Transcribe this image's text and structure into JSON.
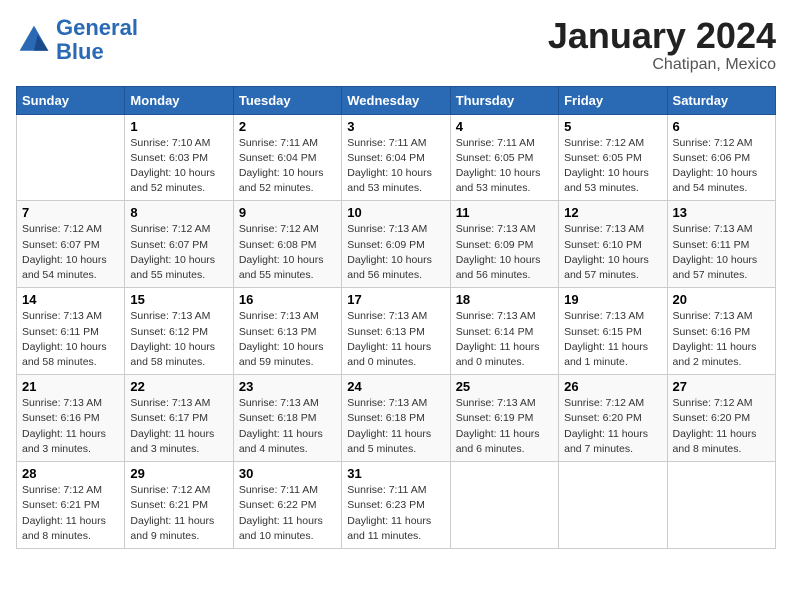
{
  "logo": {
    "text_general": "General",
    "text_blue": "Blue"
  },
  "calendar": {
    "title": "January 2024",
    "subtitle": "Chatipan, Mexico"
  },
  "days_of_week": [
    "Sunday",
    "Monday",
    "Tuesday",
    "Wednesday",
    "Thursday",
    "Friday",
    "Saturday"
  ],
  "weeks": [
    [
      {
        "day": "",
        "info": ""
      },
      {
        "day": "1",
        "info": "Sunrise: 7:10 AM\nSunset: 6:03 PM\nDaylight: 10 hours\nand 52 minutes."
      },
      {
        "day": "2",
        "info": "Sunrise: 7:11 AM\nSunset: 6:04 PM\nDaylight: 10 hours\nand 52 minutes."
      },
      {
        "day": "3",
        "info": "Sunrise: 7:11 AM\nSunset: 6:04 PM\nDaylight: 10 hours\nand 53 minutes."
      },
      {
        "day": "4",
        "info": "Sunrise: 7:11 AM\nSunset: 6:05 PM\nDaylight: 10 hours\nand 53 minutes."
      },
      {
        "day": "5",
        "info": "Sunrise: 7:12 AM\nSunset: 6:05 PM\nDaylight: 10 hours\nand 53 minutes."
      },
      {
        "day": "6",
        "info": "Sunrise: 7:12 AM\nSunset: 6:06 PM\nDaylight: 10 hours\nand 54 minutes."
      }
    ],
    [
      {
        "day": "7",
        "info": "Sunrise: 7:12 AM\nSunset: 6:07 PM\nDaylight: 10 hours\nand 54 minutes."
      },
      {
        "day": "8",
        "info": "Sunrise: 7:12 AM\nSunset: 6:07 PM\nDaylight: 10 hours\nand 55 minutes."
      },
      {
        "day": "9",
        "info": "Sunrise: 7:12 AM\nSunset: 6:08 PM\nDaylight: 10 hours\nand 55 minutes."
      },
      {
        "day": "10",
        "info": "Sunrise: 7:13 AM\nSunset: 6:09 PM\nDaylight: 10 hours\nand 56 minutes."
      },
      {
        "day": "11",
        "info": "Sunrise: 7:13 AM\nSunset: 6:09 PM\nDaylight: 10 hours\nand 56 minutes."
      },
      {
        "day": "12",
        "info": "Sunrise: 7:13 AM\nSunset: 6:10 PM\nDaylight: 10 hours\nand 57 minutes."
      },
      {
        "day": "13",
        "info": "Sunrise: 7:13 AM\nSunset: 6:11 PM\nDaylight: 10 hours\nand 57 minutes."
      }
    ],
    [
      {
        "day": "14",
        "info": "Sunrise: 7:13 AM\nSunset: 6:11 PM\nDaylight: 10 hours\nand 58 minutes."
      },
      {
        "day": "15",
        "info": "Sunrise: 7:13 AM\nSunset: 6:12 PM\nDaylight: 10 hours\nand 58 minutes."
      },
      {
        "day": "16",
        "info": "Sunrise: 7:13 AM\nSunset: 6:13 PM\nDaylight: 10 hours\nand 59 minutes."
      },
      {
        "day": "17",
        "info": "Sunrise: 7:13 AM\nSunset: 6:13 PM\nDaylight: 11 hours\nand 0 minutes."
      },
      {
        "day": "18",
        "info": "Sunrise: 7:13 AM\nSunset: 6:14 PM\nDaylight: 11 hours\nand 0 minutes."
      },
      {
        "day": "19",
        "info": "Sunrise: 7:13 AM\nSunset: 6:15 PM\nDaylight: 11 hours\nand 1 minute."
      },
      {
        "day": "20",
        "info": "Sunrise: 7:13 AM\nSunset: 6:16 PM\nDaylight: 11 hours\nand 2 minutes."
      }
    ],
    [
      {
        "day": "21",
        "info": "Sunrise: 7:13 AM\nSunset: 6:16 PM\nDaylight: 11 hours\nand 3 minutes."
      },
      {
        "day": "22",
        "info": "Sunrise: 7:13 AM\nSunset: 6:17 PM\nDaylight: 11 hours\nand 3 minutes."
      },
      {
        "day": "23",
        "info": "Sunrise: 7:13 AM\nSunset: 6:18 PM\nDaylight: 11 hours\nand 4 minutes."
      },
      {
        "day": "24",
        "info": "Sunrise: 7:13 AM\nSunset: 6:18 PM\nDaylight: 11 hours\nand 5 minutes."
      },
      {
        "day": "25",
        "info": "Sunrise: 7:13 AM\nSunset: 6:19 PM\nDaylight: 11 hours\nand 6 minutes."
      },
      {
        "day": "26",
        "info": "Sunrise: 7:12 AM\nSunset: 6:20 PM\nDaylight: 11 hours\nand 7 minutes."
      },
      {
        "day": "27",
        "info": "Sunrise: 7:12 AM\nSunset: 6:20 PM\nDaylight: 11 hours\nand 8 minutes."
      }
    ],
    [
      {
        "day": "28",
        "info": "Sunrise: 7:12 AM\nSunset: 6:21 PM\nDaylight: 11 hours\nand 8 minutes."
      },
      {
        "day": "29",
        "info": "Sunrise: 7:12 AM\nSunset: 6:21 PM\nDaylight: 11 hours\nand 9 minutes."
      },
      {
        "day": "30",
        "info": "Sunrise: 7:11 AM\nSunset: 6:22 PM\nDaylight: 11 hours\nand 10 minutes."
      },
      {
        "day": "31",
        "info": "Sunrise: 7:11 AM\nSunset: 6:23 PM\nDaylight: 11 hours\nand 11 minutes."
      },
      {
        "day": "",
        "info": ""
      },
      {
        "day": "",
        "info": ""
      },
      {
        "day": "",
        "info": ""
      }
    ]
  ]
}
